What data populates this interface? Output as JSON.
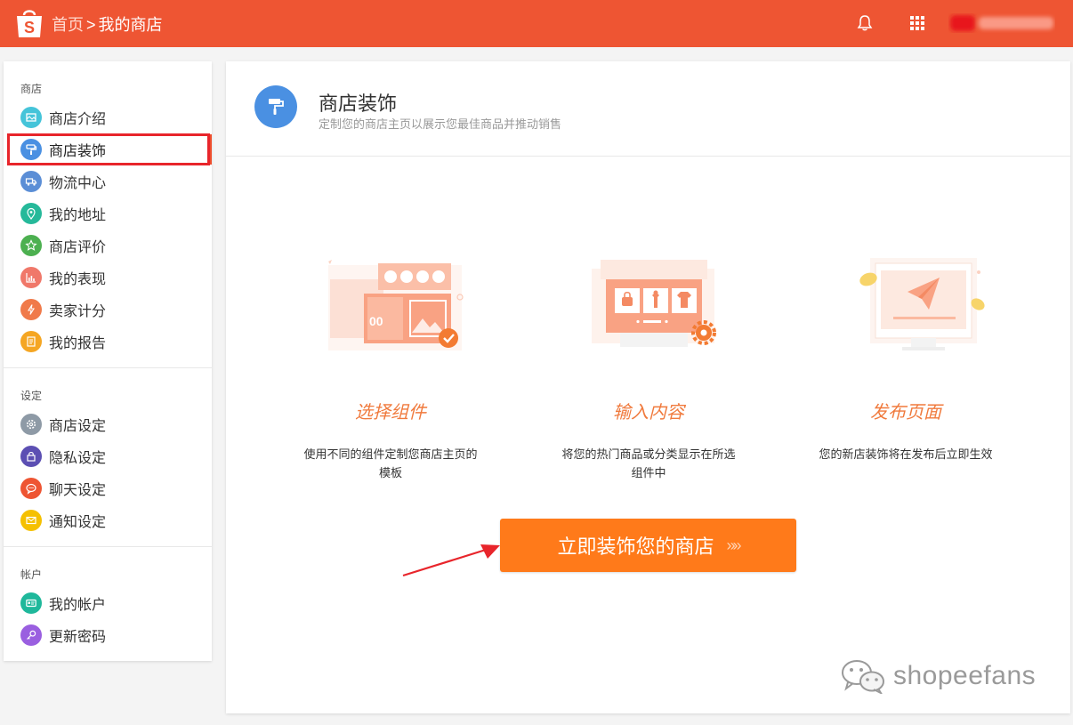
{
  "header": {
    "home_label": "首页",
    "separator": ">",
    "current_label": "我的商店",
    "bell_icon": "bell-icon",
    "apps_icon": "grid-icon",
    "brand_color": "#ee5533"
  },
  "sidebar": {
    "groups": [
      {
        "title": "商店",
        "items": [
          {
            "label": "商店介绍",
            "icon": "shop-intro-icon",
            "color": "#45c4d9"
          },
          {
            "label": "商店装饰",
            "icon": "paint-roller-icon",
            "color": "#4a90e2",
            "active": true
          },
          {
            "label": "物流中心",
            "icon": "truck-icon",
            "color": "#5b8ed6"
          },
          {
            "label": "我的地址",
            "icon": "location-pin-icon",
            "color": "#26b99a"
          },
          {
            "label": "商店评价",
            "icon": "star-icon",
            "color": "#4cb050"
          },
          {
            "label": "我的表现",
            "icon": "bar-chart-icon",
            "color": "#f0786a"
          },
          {
            "label": "卖家计分",
            "icon": "bolt-icon",
            "color": "#f07a4a"
          },
          {
            "label": "我的报告",
            "icon": "report-icon",
            "color": "#f5a623"
          }
        ]
      },
      {
        "title": "设定",
        "items": [
          {
            "label": "商店设定",
            "icon": "gear-icon",
            "color": "#8e9aa6"
          },
          {
            "label": "隐私设定",
            "icon": "lock-icon",
            "color": "#5c4fb3"
          },
          {
            "label": "聊天设定",
            "icon": "chat-icon",
            "color": "#ee5533"
          },
          {
            "label": "通知设定",
            "icon": "mail-icon",
            "color": "#f5c000"
          }
        ]
      },
      {
        "title": "帐户",
        "items": [
          {
            "label": "我的帐户",
            "icon": "id-card-icon",
            "color": "#1fb89b"
          },
          {
            "label": "更新密码",
            "icon": "key-icon",
            "color": "#9a5fe0"
          }
        ]
      }
    ]
  },
  "main": {
    "title": "商店装饰",
    "subtitle": "定制您的商店主页以展示您最佳商品并推动销售",
    "steps": [
      {
        "title": "选择组件",
        "desc": "使用不同的组件定制您商店主页的模板"
      },
      {
        "title": "输入内容",
        "desc": "将您的热门商品或分类显示在所选组件中"
      },
      {
        "title": "发布页面",
        "desc": "您的新店装饰将在发布后立即生效"
      }
    ],
    "cta_label": "立即装饰您的商店",
    "cta_chevrons": "»»",
    "cta_color": "#ff7a1a",
    "illus_text": "00"
  },
  "watermark": {
    "text": "shopeefans",
    "icon": "wechat-icon"
  }
}
